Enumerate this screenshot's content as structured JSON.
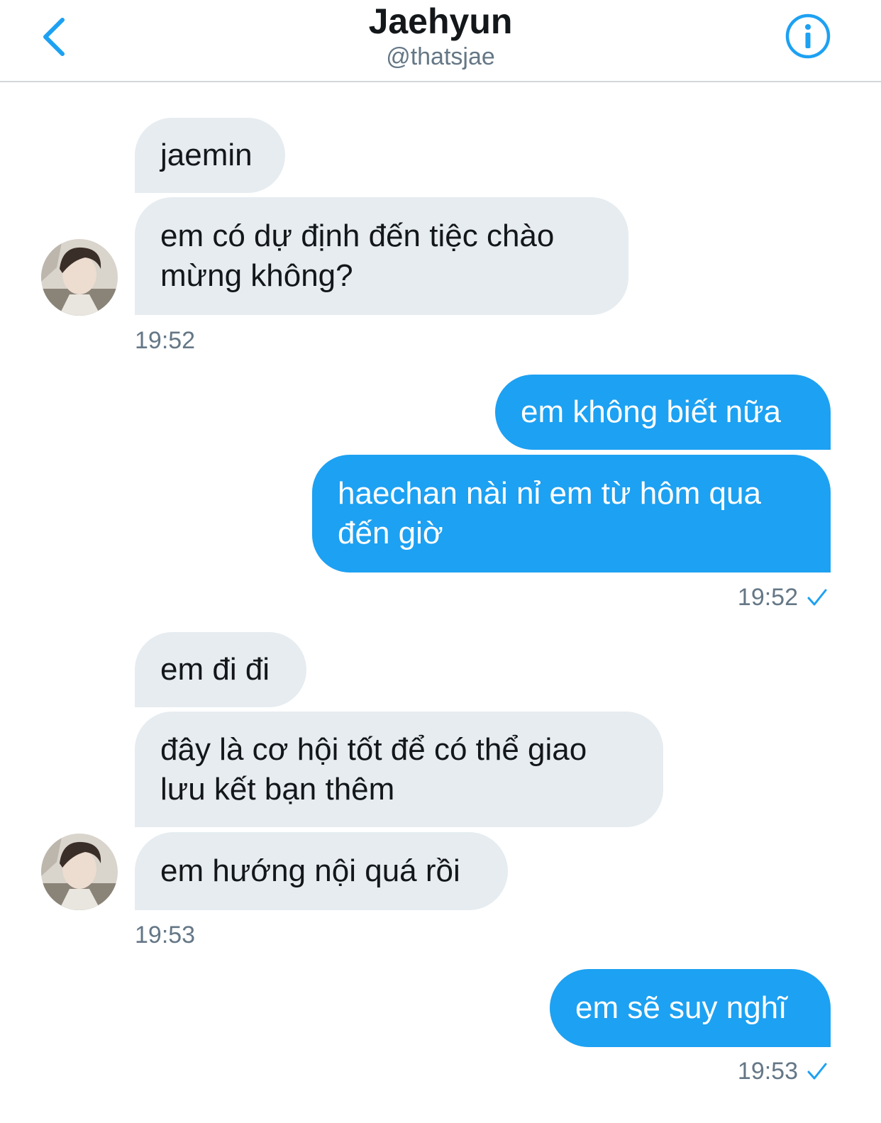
{
  "header": {
    "title": "Jaehyun",
    "handle": "@thatsjae",
    "back_icon": "chevron-left-icon",
    "info_icon": "info-icon",
    "accent_color": "#1da1f2"
  },
  "messages": {
    "m1": "jaemin",
    "m2": "em có dự định đến tiệc chào mừng không?",
    "t1": "19:52",
    "m3": "em không biết nữa",
    "m4": "haechan nài nỉ em từ hôm qua đến giờ",
    "t2": "19:52",
    "m5": "em đi đi",
    "m6": "đây là cơ hội tốt để có thể giao lưu kết bạn thêm",
    "m7": "em hướng nội quá rồi",
    "t3": "19:53",
    "m8": "em sẽ suy nghĩ",
    "t4": "19:53"
  },
  "colors": {
    "received_bubble": "#e6ecf0",
    "sent_bubble": "#1da1f2",
    "timestamp": "#657786"
  }
}
